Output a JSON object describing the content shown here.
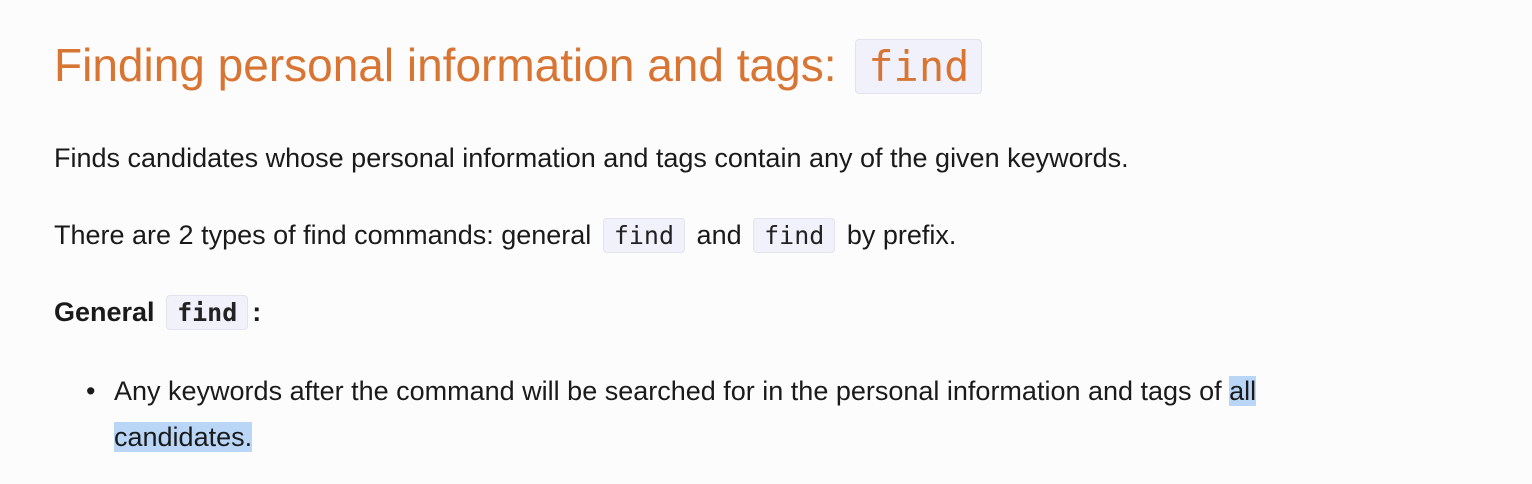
{
  "heading": {
    "text": "Finding personal information and tags:",
    "code": "find"
  },
  "paragraphs": {
    "intro": "Finds candidates whose personal information and tags contain any of the given keywords.",
    "types": {
      "before": "There are 2 types of find commands: general",
      "code1": "find",
      "middle": "and",
      "code2": "find",
      "after": "by prefix."
    },
    "general": {
      "label": "General",
      "code": "find",
      "suffix": ":"
    }
  },
  "list": {
    "bullet": "•",
    "item1": {
      "text": "Any keywords after the command will be searched for in the personal information and tags of",
      "selected_line1": "all",
      "selected_line2": "candidates."
    }
  },
  "colors": {
    "heading": "#d97533",
    "code_background": "#f1f1fb",
    "selection": "#b9d6f7"
  }
}
